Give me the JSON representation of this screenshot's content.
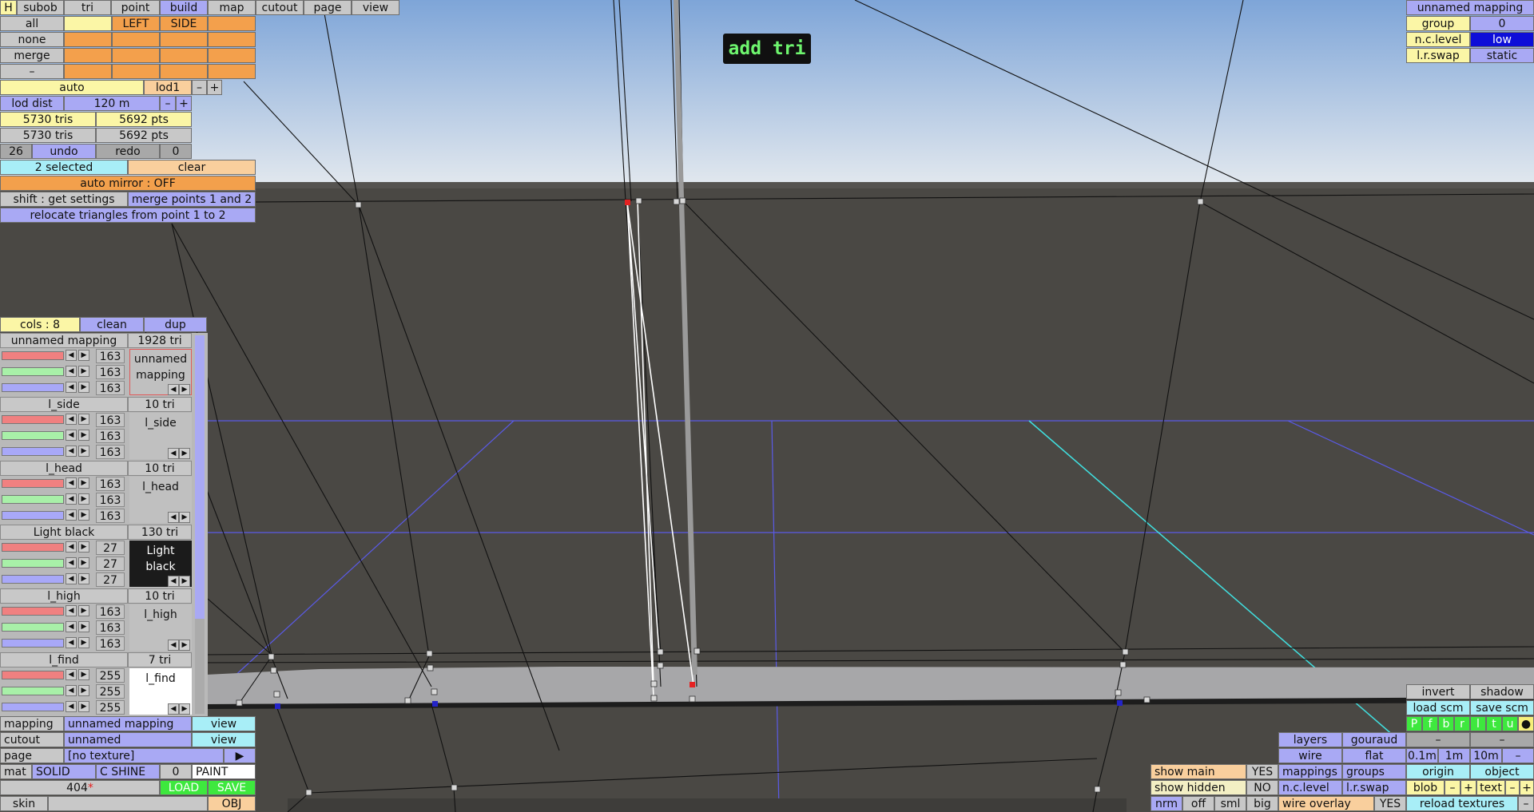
{
  "colors": {
    "sky_top": "#7ea5d8",
    "sky_bottom": "#dfe6ec",
    "ground": "#4a4844",
    "accent_orange": "#f3a04c",
    "accent_blue": "#a9a9f4"
  },
  "menu": {
    "h": "H",
    "tabs": [
      "subob",
      "tri",
      "point",
      "build",
      "map",
      "cutout",
      "page",
      "view"
    ],
    "active": "build"
  },
  "select_row": {
    "all": "all",
    "left": "LEFT",
    "side": "SIDE",
    "none": "none",
    "merge": "merge",
    "dash": "–"
  },
  "lod": {
    "auto": "auto",
    "name": "lod1",
    "minus": "–",
    "plus": "+",
    "dist_label": "lod dist",
    "dist_value": "120 m"
  },
  "stats": {
    "tris1": "5730 tris",
    "pts1": "5692 pts",
    "tris2": "5730 tris",
    "pts2": "5692 pts"
  },
  "history": {
    "undo_count": "26",
    "undo": "undo",
    "redo": "redo",
    "redo_count": "0"
  },
  "selection": {
    "selected": "2 selected",
    "clear": "clear",
    "auto_mirror": "auto mirror : OFF",
    "shift": "shift : get settings",
    "merge_points": "merge points 1 and 2",
    "relocate": "relocate triangles from point 1 to 2"
  },
  "hint": "add tri",
  "mapping_top": {
    "title": "unnamed mapping",
    "group_label": "group",
    "group_value": "0",
    "nclevel_label": "n.c.level",
    "nclevel_value": "low",
    "lrswap_label": "l.r.swap",
    "lrswap_value": "static"
  },
  "cols": {
    "label": "cols : 8",
    "clean": "clean",
    "dup": "dup"
  },
  "materials": [
    {
      "name": "unnamed mapping",
      "tri": "1928 tri",
      "r": "163",
      "g": "163",
      "b": "163",
      "preview": "unnamed mapping",
      "preview_bg": "#c0c0c0",
      "preview_fg": "#111111",
      "border": "#e05a5a"
    },
    {
      "name": "l_side",
      "tri": "10 tri",
      "r": "163",
      "g": "163",
      "b": "163",
      "preview": "l_side",
      "preview_bg": "#c0c0c0",
      "preview_fg": "#111111",
      "border": "#c0c0c0"
    },
    {
      "name": "l_head",
      "tri": "10 tri",
      "r": "163",
      "g": "163",
      "b": "163",
      "preview": "l_head",
      "preview_bg": "#c0c0c0",
      "preview_fg": "#111111",
      "border": "#c0c0c0"
    },
    {
      "name": "Light black",
      "tri": "130 tri",
      "r": "27",
      "g": "27",
      "b": "27",
      "preview": "Light black",
      "preview_bg": "#1b1b1b",
      "preview_fg": "#ffffff",
      "border": "#1b1b1b"
    },
    {
      "name": "l_high",
      "tri": "10 tri",
      "r": "163",
      "g": "163",
      "b": "163",
      "preview": "l_high",
      "preview_bg": "#c0c0c0",
      "preview_fg": "#111111",
      "border": "#c0c0c0"
    },
    {
      "name": "l_find",
      "tri": "7 tri",
      "r": "255",
      "g": "255",
      "b": "255",
      "preview": "l_find",
      "preview_bg": "#ffffff",
      "preview_fg": "#111111",
      "border": "#ffffff"
    }
  ],
  "bottom_left": {
    "mapping_label": "mapping",
    "mapping_value": "unnamed mapping",
    "view1": "view",
    "cutout_label": "cutout",
    "cutout_value": "unnamed",
    "view2": "view",
    "page_label": "page",
    "page_value": "[no texture]",
    "mat": "mat",
    "solid": "SOLID",
    "cshine": "C SHINE",
    "zero": "0",
    "paint": "PAINT",
    "count": "404",
    "load": "LOAD",
    "save": "SAVE",
    "skin": "skin",
    "obj": "OBJ"
  },
  "bottom_right": {
    "invert": "invert",
    "shadow": "shadow",
    "load_scm": "load scm",
    "save_scm": "save scm",
    "letters": [
      "P",
      "f",
      "b",
      "r",
      "l",
      "t",
      "u",
      "●"
    ],
    "layers": "layers",
    "gouraud": "gouraud",
    "dash": "–",
    "wire": "wire",
    "flat": "flat",
    "m01": "0.1m",
    "m1": "1m",
    "m10": "10m",
    "show_main": "show main",
    "yes1": "YES",
    "mappings": "mappings",
    "groups": "groups",
    "origin": "origin",
    "object": "object",
    "show_hidden": "show hidden",
    "no": "NO",
    "nclevel": "n.c.level",
    "lrswap": "l.r.swap",
    "blob": "blob",
    "minus": "–",
    "plus": "+",
    "text": "text",
    "nrm": "nrm",
    "off": "off",
    "sml": "sml",
    "big": "big",
    "wire_overlay": "wire overlay",
    "yes2": "YES",
    "reload": "reload textures"
  }
}
